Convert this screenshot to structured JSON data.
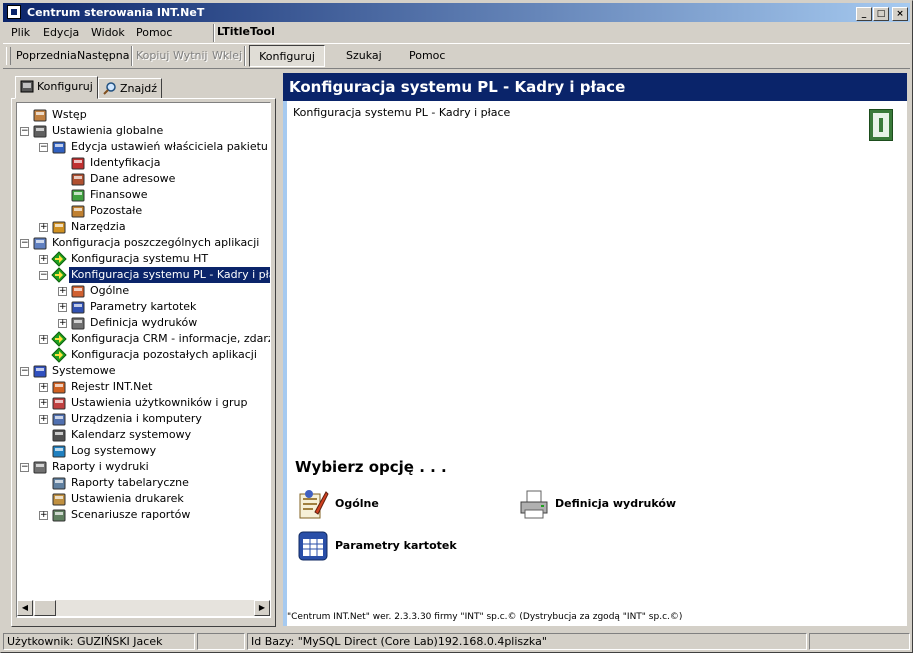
{
  "window": {
    "title": "Centrum sterowania INT.NeT",
    "buttons": {
      "minimize": "_",
      "maximize": "□",
      "close": "×"
    }
  },
  "menubar": {
    "items": [
      "Plik",
      "Edycja",
      "Widok",
      "Pomoc"
    ],
    "ltitle": "LTitleTool"
  },
  "toolbar": {
    "prev": "Poprzednia",
    "next": "Następna",
    "copy": "Kopiuj",
    "cut": "Wytnij",
    "paste": "Wklej",
    "configure": "Konfiguruj",
    "search": "Szukaj",
    "help": "Pomoc"
  },
  "left_tabs": {
    "configure": "Konfiguruj",
    "find": "Znajdź"
  },
  "tree": [
    {
      "label": "Wstęp",
      "icon": "book-icon"
    },
    {
      "label": "Ustawienia globalne",
      "icon": "gear-box-icon"
    },
    {
      "label": "Edycja ustawień właściciela pakietu",
      "icon": "edit-icon"
    },
    {
      "label": "Identyfikacja",
      "icon": "id-card-icon"
    },
    {
      "label": "Dane adresowe",
      "icon": "address-icon"
    },
    {
      "label": "Finansowe",
      "icon": "money-icon"
    },
    {
      "label": "Pozostałe",
      "icon": "misc-icon"
    },
    {
      "label": "Narzędzia",
      "icon": "tools-icon"
    },
    {
      "label": "Konfiguracja poszczególnych aplikacji",
      "icon": "apps-icon"
    },
    {
      "label": "Konfiguracja systemu HT",
      "icon": "green-arrow-icon"
    },
    {
      "label": "Konfiguracja systemu PL - Kadry i płace",
      "icon": "green-arrow-icon"
    },
    {
      "label": "Ogólne",
      "icon": "general-icon"
    },
    {
      "label": "Parametry kartotek",
      "icon": "table-icon"
    },
    {
      "label": "Definicja wydruków",
      "icon": "printer-icon"
    },
    {
      "label": "Konfiguracja CRM - informacje, zdarzenia",
      "icon": "green-arrow-icon"
    },
    {
      "label": "Konfiguracja pozostałych aplikacji",
      "icon": "green-arrow-icon"
    },
    {
      "label": "Systemowe",
      "icon": "system-icon"
    },
    {
      "label": "Rejestr INT.Net",
      "icon": "registry-icon"
    },
    {
      "label": "Ustawienia użytkowników i grup",
      "icon": "users-icon"
    },
    {
      "label": "Urządzenia i komputery",
      "icon": "computer-icon"
    },
    {
      "label": "Kalendarz systemowy",
      "icon": "calendar-icon"
    },
    {
      "label": "Log systemowy",
      "icon": "log-icon"
    },
    {
      "label": "Raporty i wydruki",
      "icon": "reports-icon"
    },
    {
      "label": "Raporty tabelaryczne",
      "icon": "table-report-icon"
    },
    {
      "label": "Ustawienia drukarek",
      "icon": "printer-settings-icon"
    },
    {
      "label": "Scenariusze raportów",
      "icon": "scenario-icon"
    }
  ],
  "content": {
    "header": "Konfiguracja systemu PL - Kadry i płace",
    "subtitle": "Konfiguracja systemu PL - Kadry i płace",
    "choose": "Wybierz opcję . . .",
    "options": [
      "Ogólne",
      "Definicja wydruków",
      "Parametry kartotek"
    ],
    "footer": "\"Centrum INT.Net\" wer. 2.3.3.30 firmy \"INT\" sp.c.© (Dystrybucja za zgodą \"INT\" sp.c.©)"
  },
  "statusbar": {
    "user": "Użytkownik: GUZIŃSKI Jacek",
    "db": "Id Bazy: \"MySQL Direct (Core Lab)192.168.0.4pliszka\""
  },
  "colors": {
    "accent": "#0a246a",
    "face": "#d4d0c8",
    "selected": "#0a246a"
  }
}
